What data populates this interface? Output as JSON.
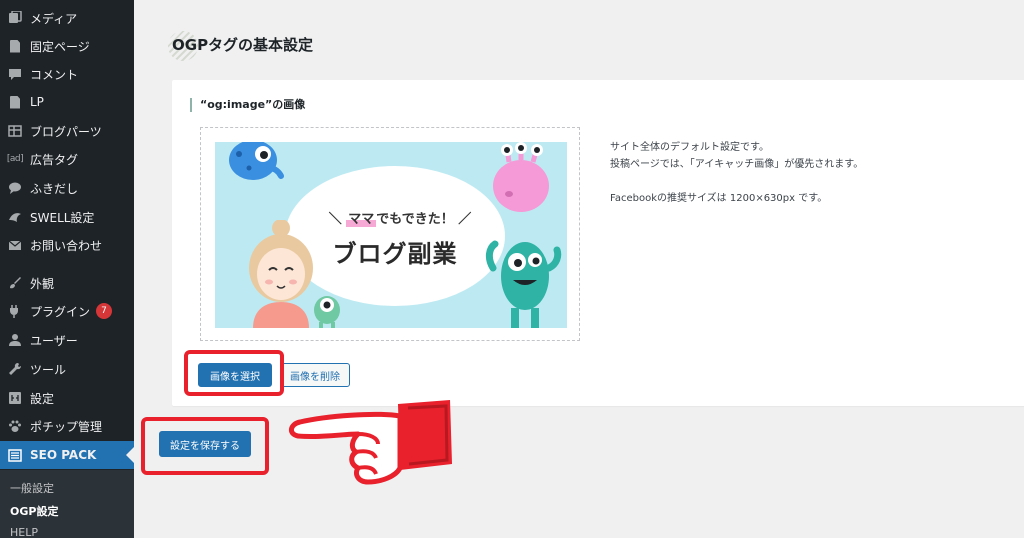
{
  "sidebar": {
    "items": [
      {
        "label": "メディア",
        "icon": "media-icon"
      },
      {
        "label": "固定ページ",
        "icon": "page-icon"
      },
      {
        "label": "コメント",
        "icon": "comment-icon"
      },
      {
        "label": "LP",
        "icon": "document-icon"
      },
      {
        "label": "ブログパーツ",
        "icon": "table-icon"
      },
      {
        "label": "広告タグ",
        "icon": "ad-icon"
      },
      {
        "label": "ふきだし",
        "icon": "speech-bubble-icon"
      },
      {
        "label": "SWELL設定",
        "icon": "swell-icon"
      },
      {
        "label": "お問い合わせ",
        "icon": "envelope-icon"
      },
      {
        "label": "外観",
        "icon": "brush-icon"
      },
      {
        "label": "プラグイン",
        "icon": "plugin-icon",
        "badge": "7"
      },
      {
        "label": "ユーザー",
        "icon": "user-icon"
      },
      {
        "label": "ツール",
        "icon": "wrench-icon"
      },
      {
        "label": "設定",
        "icon": "settings-icon"
      },
      {
        "label": "ポチップ管理",
        "icon": "paw-icon"
      },
      {
        "label": "SEO PACK",
        "icon": "list-icon",
        "active": true
      }
    ],
    "submenu": [
      "一般設定",
      "OGP設定",
      "HELP"
    ],
    "current_submenu": "OGP設定"
  },
  "main": {
    "section_title": "OGPタグの基本設定",
    "field_title": "“og:image”の画像",
    "banner": {
      "catch_prefix": "＼",
      "catch_highlight": "ママ",
      "catch_text": "でもできた！",
      "catch_suffix": "／",
      "headline": "ブログ副業"
    },
    "description": [
      "サイト全体のデフォルト設定です。",
      "投稿ページでは、「アイキャッチ画像」が優先されます。",
      "Facebookの推奨サイズは 1200×630px です。"
    ],
    "select_image_label": "画像を選択",
    "remove_image_label": "画像を削除",
    "save_label": "設定を保存する"
  },
  "colors": {
    "sidebar_bg": "#1d2327",
    "accent": "#2271b1",
    "highlight": "#e8212d",
    "badge": "#d63638"
  }
}
